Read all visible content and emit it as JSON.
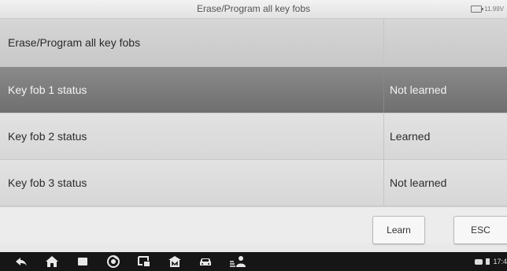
{
  "header": {
    "title": "Erase/Program all key fobs",
    "battery_voltage": "11.99V"
  },
  "table": {
    "rows": [
      {
        "label": "Erase/Program all key fobs",
        "value": ""
      },
      {
        "label": "Key fob 1 status",
        "value": "Not learned"
      },
      {
        "label": "Key fob 2 status",
        "value": "Learned"
      },
      {
        "label": "Key fob 3 status",
        "value": "Not learned"
      }
    ]
  },
  "actions": {
    "learn_label": "Learn",
    "esc_label": "ESC"
  },
  "navbar": {
    "icons": [
      "back-icon",
      "home-icon",
      "recent-apps-icon",
      "chrome-icon",
      "screenshot-icon",
      "maxifix-icon",
      "car-icon",
      "vci-person-icon"
    ],
    "time": "17:4"
  }
}
